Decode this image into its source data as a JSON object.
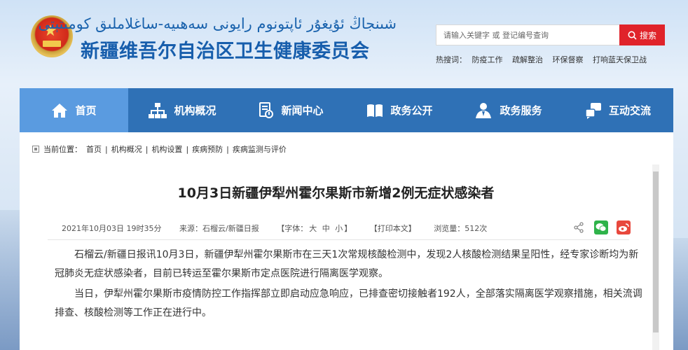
{
  "header": {
    "uyghur_title": "شىنجاڭ ئۇيغۇر ئاپتونوم رايونى سەھىيە-ساغلاملىق كومىتېتى",
    "site_title": "新疆维吾尔自治区卫生健康委员会",
    "search": {
      "placeholder": "请输入关键字 或 登记编号查询",
      "button_label": "搜索"
    },
    "hot_words": {
      "label": "热搜词：",
      "items": [
        "防疫工作",
        "疏解整治",
        "环保督察",
        "打响蓝天保卫战"
      ]
    }
  },
  "nav": {
    "items": [
      {
        "label": "首页",
        "icon": "home-icon",
        "active": true
      },
      {
        "label": "机构概况",
        "icon": "org-chart-icon",
        "active": false
      },
      {
        "label": "新闻中心",
        "icon": "news-icon",
        "active": false
      },
      {
        "label": "政务公开",
        "icon": "book-icon",
        "active": false
      },
      {
        "label": "政务服务",
        "icon": "person-service-icon",
        "active": false
      },
      {
        "label": "互动交流",
        "icon": "interaction-icon",
        "active": false
      }
    ]
  },
  "breadcrumb": {
    "label": "当前位置：",
    "items": [
      "首页",
      "机构概况",
      "机构设置",
      "疾病预防",
      "疾病监测与评价"
    ]
  },
  "article": {
    "title": "10月3日新疆伊犁州霍尔果斯市新增2例无症状感染者",
    "meta": {
      "date": "2021年10月03日 19时35分",
      "source": "来源：石榴云/新疆日报",
      "font_size_prefix": "【字体：",
      "font_large": "大",
      "font_medium": "中",
      "font_small": "小",
      "font_size_suffix": "】",
      "print": "【打印本文】",
      "views": "浏览量：512次"
    },
    "paragraphs": [
      "石榴云/新疆日报讯10月3日，新疆伊犁州霍尔果斯市在三天1次常规核酸检测中，发现2人核酸检测结果呈阳性，经专家诊断均为新冠肺炎无症状感染者，目前已转运至霍尔果斯市定点医院进行隔离医学观察。",
      "当日，伊犁州霍尔果斯市疫情防控工作指挥部立即启动应急响应，已排查密切接触者192人，全部落实隔离医学观察措施，相关流调排查、核酸检测等工作正在进行中。"
    ]
  },
  "colors": {
    "brand_blue": "#175eac",
    "nav_bg": "#2f71b6",
    "nav_active": "#5a9be0",
    "search_red": "#e0232a"
  }
}
